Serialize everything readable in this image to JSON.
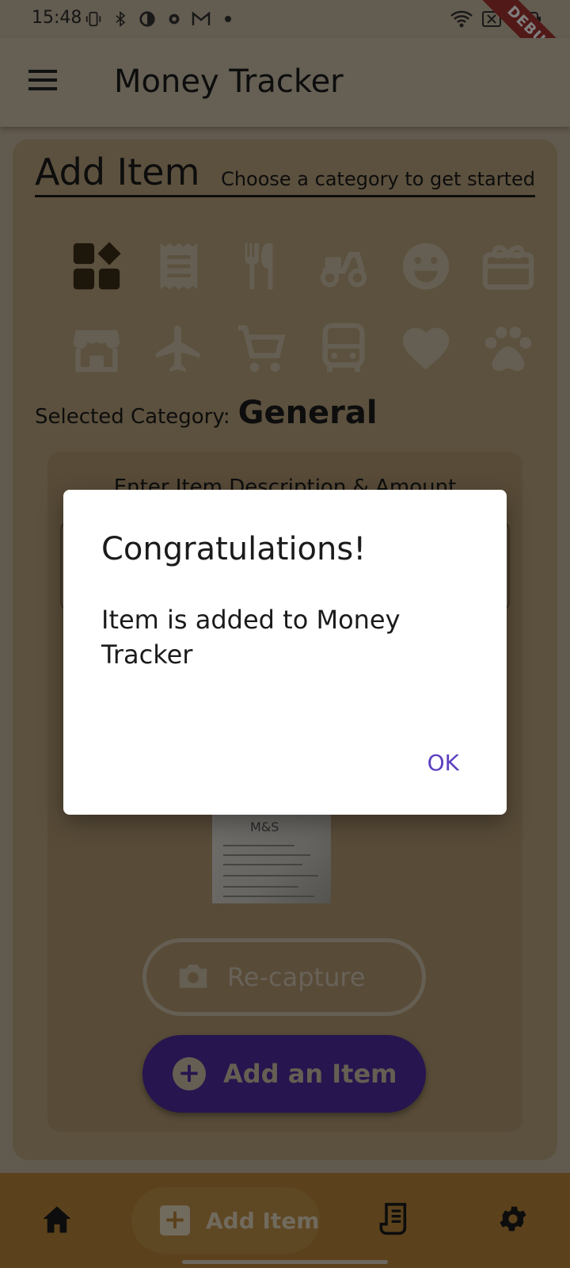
{
  "status_bar": {
    "time": "15:48",
    "left_icons": [
      "vibrate-icon",
      "bluetooth-icon",
      "data-saver-icon",
      "settings-icon",
      "gmail-icon",
      "dot-icon"
    ],
    "right_icons": [
      "wifi-icon",
      "no-sim-icon",
      "battery-icon"
    ]
  },
  "debug_banner": "DEBUG",
  "app_bar": {
    "title": "Money Tracker"
  },
  "add_item": {
    "title": "Add Item",
    "subtitle": "Choose a category to get started",
    "categories": [
      "general-icon",
      "receipt-icon",
      "restaurant-icon",
      "delivery-icon",
      "smiley-icon",
      "gift-icon",
      "store-icon",
      "flight-icon",
      "cart-icon",
      "bus-icon",
      "heart-icon",
      "pets-icon"
    ],
    "selected_label": "Selected Category:",
    "selected_value": "General",
    "prompt": "Enter Item Description & Amount",
    "receipt_text": "M&S",
    "recapture_label": "Re-capture",
    "add_label": "Add an Item"
  },
  "bottom_nav": {
    "add_item_label": "Add Item"
  },
  "dialog": {
    "title": "Congratulations!",
    "message": "Item is added to Money Tracker",
    "ok_label": "OK"
  },
  "colors": {
    "accent": "#5b3fbf",
    "button_primary": "#4e2b9e",
    "bottom_nav": "#b78538",
    "card": "#b8a27c"
  }
}
